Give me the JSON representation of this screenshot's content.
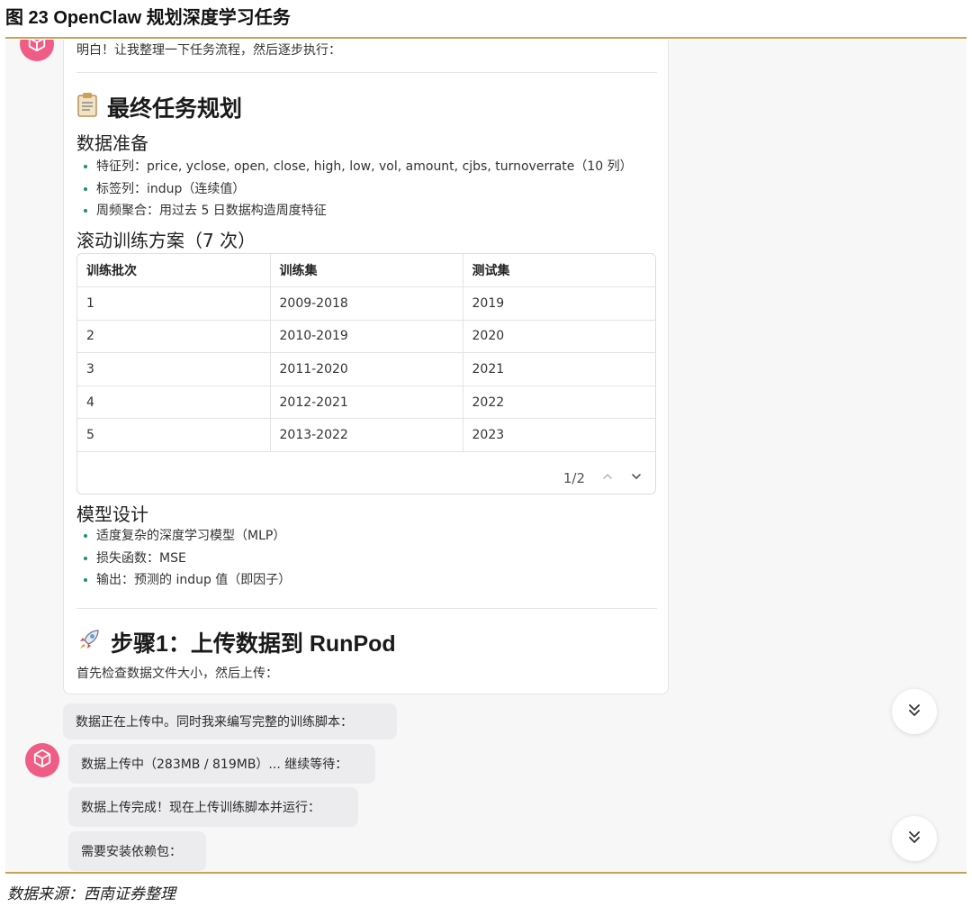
{
  "figure": {
    "title": "图 23   OpenClaw 规划深度学习任务",
    "source": "数据来源：西南证券整理"
  },
  "chat": {
    "intro": "明白！让我整理一下任务流程，然后逐步执行：",
    "plan_heading_icon": "clipboard-icon",
    "plan_heading": "最终任务规划",
    "data_prep_heading": "数据准备",
    "data_prep_items": [
      "特征列：price, yclose, open, close, high, low, vol, amount, cjbs, turnoverrate（10 列）",
      "标签列：indup（连续值）",
      "周频聚合：用过去 5 日数据构造周度特征"
    ],
    "rolling_heading": "滚动训练方案（7 次）",
    "table": {
      "columns": [
        "训练批次",
        "训练集",
        "测试集"
      ],
      "rows": [
        [
          "1",
          "2009-2018",
          "2019"
        ],
        [
          "2",
          "2010-2019",
          "2020"
        ],
        [
          "3",
          "2011-2020",
          "2021"
        ],
        [
          "4",
          "2012-2021",
          "2022"
        ],
        [
          "5",
          "2013-2022",
          "2023"
        ]
      ],
      "pagination": "1/2"
    },
    "model_heading": "模型设计",
    "model_items": [
      "适度复杂的深度学习模型（MLP）",
      "损失函数：MSE",
      "输出：预测的 indup 值（即因子）"
    ],
    "step1_icon": "rocket-icon",
    "step1_heading": "步骤1：上传数据到 RunPod",
    "step1_text": "首先检查数据文件大小，然后上传：",
    "messages": [
      "数据正在上传中。同时我来编写完整的训练脚本：",
      "数据上传中（283MB / 819MB）... 继续等待：",
      "数据上传完成！现在上传训练脚本并运行：",
      "需要安装依赖包："
    ]
  },
  "colors": {
    "accent_rule": "#c9a35a",
    "avatar": "#ef5d86",
    "bullet": "#1c8f7a",
    "bubble": "#ececee"
  }
}
